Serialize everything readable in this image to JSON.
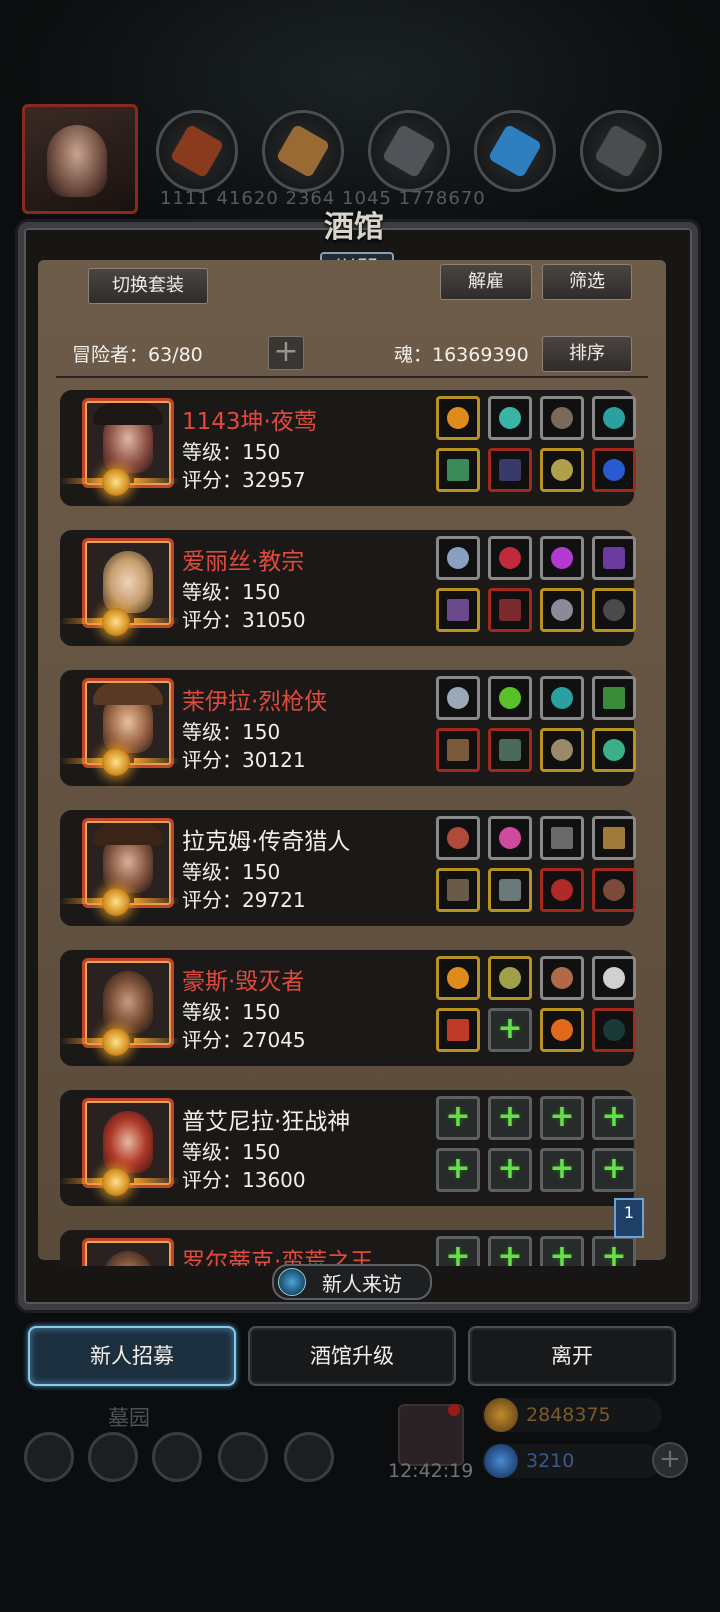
{
  "top": {
    "resource_numbers": "1111   41620   2364   1045   1778670"
  },
  "panel": {
    "title": "酒馆",
    "level": "LV.77",
    "switch_outfit_label": "切换套装",
    "dismiss_label": "解雇",
    "filter_label": "筛选",
    "sort_label": "排序",
    "adventurers_text": "冒险者：63/80",
    "plus_label": "+",
    "soul_text": "魂：16369390"
  },
  "heroes": [
    {
      "name": "1143坤·夜莺",
      "name_color": "red",
      "level": "等级：150",
      "score": "评分：32957"
    },
    {
      "name": "爱丽丝·教宗",
      "name_color": "red",
      "level": "等级：150",
      "score": "评分：31050"
    },
    {
      "name": "茉伊拉·烈枪侠",
      "name_color": "red",
      "level": "等级：150",
      "score": "评分：30121"
    },
    {
      "name": "拉克姆·传奇猎人",
      "name_color": "white",
      "level": "等级：150",
      "score": "评分：29721"
    },
    {
      "name": "豪斯·毁灭者",
      "name_color": "red",
      "level": "等级：150",
      "score": "评分：27045"
    },
    {
      "name": "普艾尼拉·狂战神",
      "name_color": "white",
      "level": "等级：150",
      "score": "评分：13600"
    },
    {
      "name": "罗尔蒂克·蛮荒之王",
      "name_color": "red",
      "level": "",
      "score": ""
    }
  ],
  "page_flag": "1",
  "visit_label": "新人来访",
  "bottom_buttons": {
    "recruit": "新人招募",
    "upgrade": "酒馆升级",
    "leave": "离开"
  },
  "background": {
    "area_label": "墓园",
    "time": "12:42:19",
    "gold": "2848375",
    "gems": "3210",
    "plus": "+"
  },
  "colors": {
    "name_red": "#e04a3c",
    "accent_blue": "#8ec6e6",
    "equip_plus": "#66e04a"
  }
}
